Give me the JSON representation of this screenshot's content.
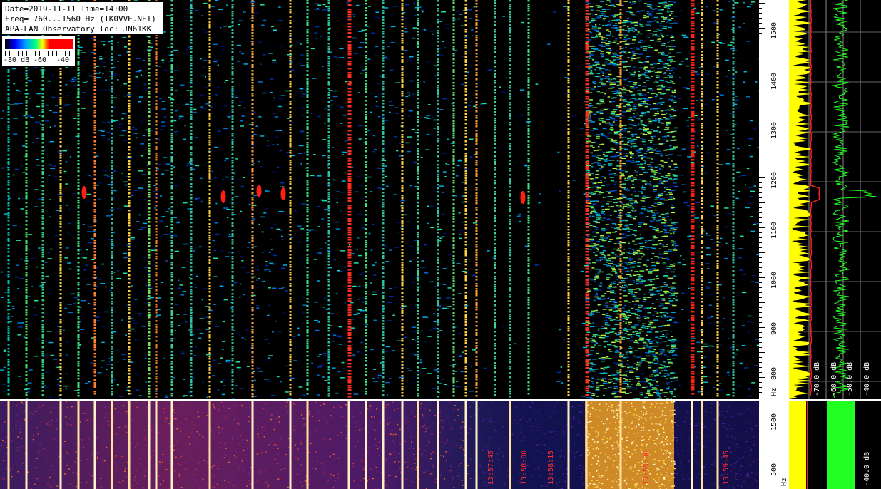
{
  "header": {
    "line1": "Date=2019-11-11 Time=14:00",
    "line2": "Freq= 760...1560 Hz (IK0VVE.NET)",
    "line3": "APA-LAN Observatory loc: JN61KK"
  },
  "color_scale": {
    "label_left": "-80 dB",
    "label_mid": "-60",
    "label_right": "-40"
  },
  "freq_axis": {
    "unit": "Hz",
    "labels": [
      "1500",
      "1400",
      "1300",
      "1200",
      "1100",
      "1000",
      "900",
      "800"
    ],
    "mini_labels": [
      "1500",
      "500"
    ],
    "mini_unit": "Hz"
  },
  "spectrum_axis": {
    "labels": [
      "-70.0 dB",
      "-60.0 dB",
      "-50.0 dB",
      "-40.0 dB"
    ],
    "mini_label": "-40.0 dB",
    "colors": {
      "yellow": "#ffff00",
      "red": "#ff2020",
      "green": "#22ff22"
    }
  },
  "mini_timestamps": [
    "13:57:45",
    "13:58:00",
    "13:58:15",
    "13:59:00",
    "13:59:45"
  ]
}
